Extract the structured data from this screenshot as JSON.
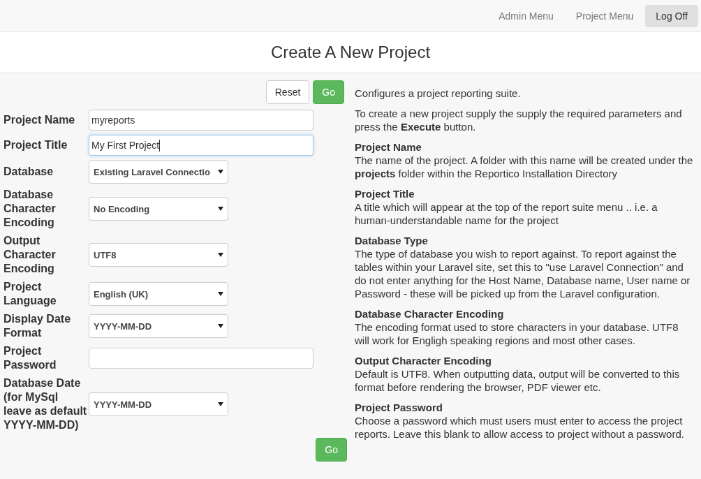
{
  "nav": [
    {
      "label": "Admin Menu",
      "selected": false
    },
    {
      "label": "Project Menu",
      "selected": false
    },
    {
      "label": "Log Off",
      "selected": true
    }
  ],
  "title": "Create A New Project",
  "form": {
    "top_buttons": [
      {
        "label": "Reset",
        "kind": "default"
      },
      {
        "label": "Go",
        "kind": "primary"
      }
    ],
    "fields": [
      {
        "label": "Project Name",
        "kind": "text",
        "value": "myreports",
        "focused": false
      },
      {
        "label": "Project Title",
        "kind": "text",
        "value": "My First Project",
        "focused": true
      },
      {
        "label": "Database",
        "kind": "select",
        "value": "Existing Laravel Connectio"
      },
      {
        "label": "Database Character Encoding",
        "kind": "select",
        "value": "No Encoding"
      },
      {
        "label": "Output Character Encoding",
        "kind": "select",
        "value": "UTF8"
      },
      {
        "label": "Project Language",
        "kind": "select",
        "value": "English (UK)"
      },
      {
        "label": "Display Date Format",
        "kind": "select",
        "value": "YYYY-MM-DD"
      },
      {
        "label": "Project Password",
        "kind": "text",
        "focused": false
      },
      {
        "label": "Database Date (for MySql leave as default YYYY-MM-DD)",
        "kind": "select",
        "value": "YYYY-MM-DD"
      }
    ],
    "bottom_button": {
      "label": "Go",
      "kind": "primary"
    }
  },
  "help": {
    "intro": [
      "Configures a project reporting suite.",
      "To create a new project supply the supply the required parameters and press the **Execute** button."
    ],
    "sections": [
      {
        "heading": "Project Name",
        "text": "The name of the project. A folder with this name will be created under the **projects** folder within the Reportico Installation Directory"
      },
      {
        "heading": "Project Title",
        "text": "A title which will appear at the top of the report suite menu .. i.e. a human-understandable name for the project"
      },
      {
        "heading": "Database Type",
        "text": "The type of database you wish to report against. To report against the tables within your Laravel site, set this to \"use Laravel Connection\" and do not enter anything for the Host Name, Database name, User name or Password - these will be picked up from the Laravel configuration."
      },
      {
        "heading": "Database Character Encoding",
        "text": "The encoding format used to store characters in your database. UTF8 will work for Engligh speaking regions and most other cases."
      },
      {
        "heading": "Output Character Encoding",
        "text": "Default is UTF8. When outputting data, output will be converted to this format before rendering the browser, PDF viewer etc."
      },
      {
        "heading": "Project Password",
        "text": "Choose a password which must users must enter to access the project reports. Leave this blank to allow access to project without a password."
      }
    ]
  }
}
